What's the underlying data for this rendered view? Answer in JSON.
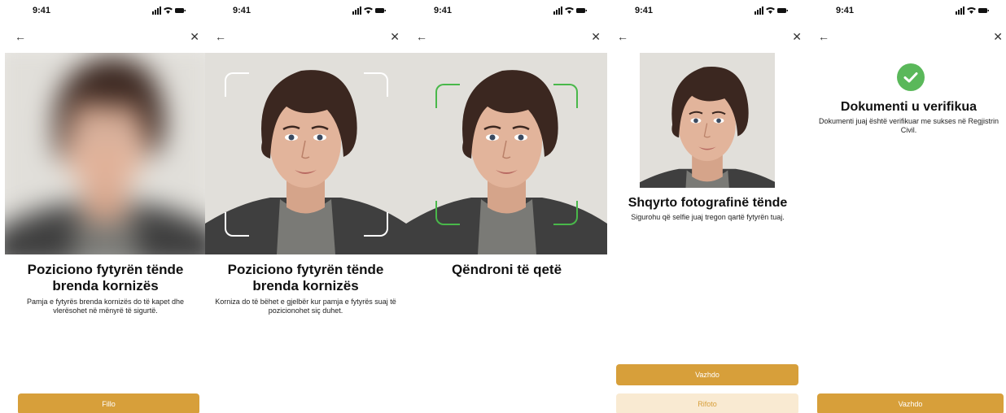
{
  "status_time": "9:41",
  "screens": [
    {
      "title": "Poziciono fytyrën tënde brenda kornizës",
      "subtitle": "Pamja e fytyrës brenda kornizës do të kapet dhe vlerësohet në mënyrë të sigurtë.",
      "primary_button": "Fillo"
    },
    {
      "title": "Poziciono fytyrën tënde brenda kornizës",
      "subtitle": "Korniza do të bëhet e gjelbër kur pamja e fytyrës suaj të pozicionohet siç duhet.",
      "frame_color": "#ffffff"
    },
    {
      "title": "Qëndroni të qetë",
      "frame_color": "#49b84a"
    },
    {
      "title": "Shqyrto fotografinë tënde",
      "subtitle": "Sigurohu që selfie juaj tregon qartë fytyrën tuaj.",
      "primary_button": "Vazhdo",
      "secondary_button": "Rifoto"
    },
    {
      "title": "Dokumenti u verifikua",
      "subtitle": "Dokumenti juaj është verifikuar me sukses në Regjistrin Civil.",
      "primary_button": "Vazhdo",
      "status_icon": "check-circle-icon",
      "status_color": "#5ab85a"
    }
  ],
  "colors": {
    "accent": "#d79f3a",
    "accent_light": "#f9ead2",
    "success": "#5ab85a"
  }
}
